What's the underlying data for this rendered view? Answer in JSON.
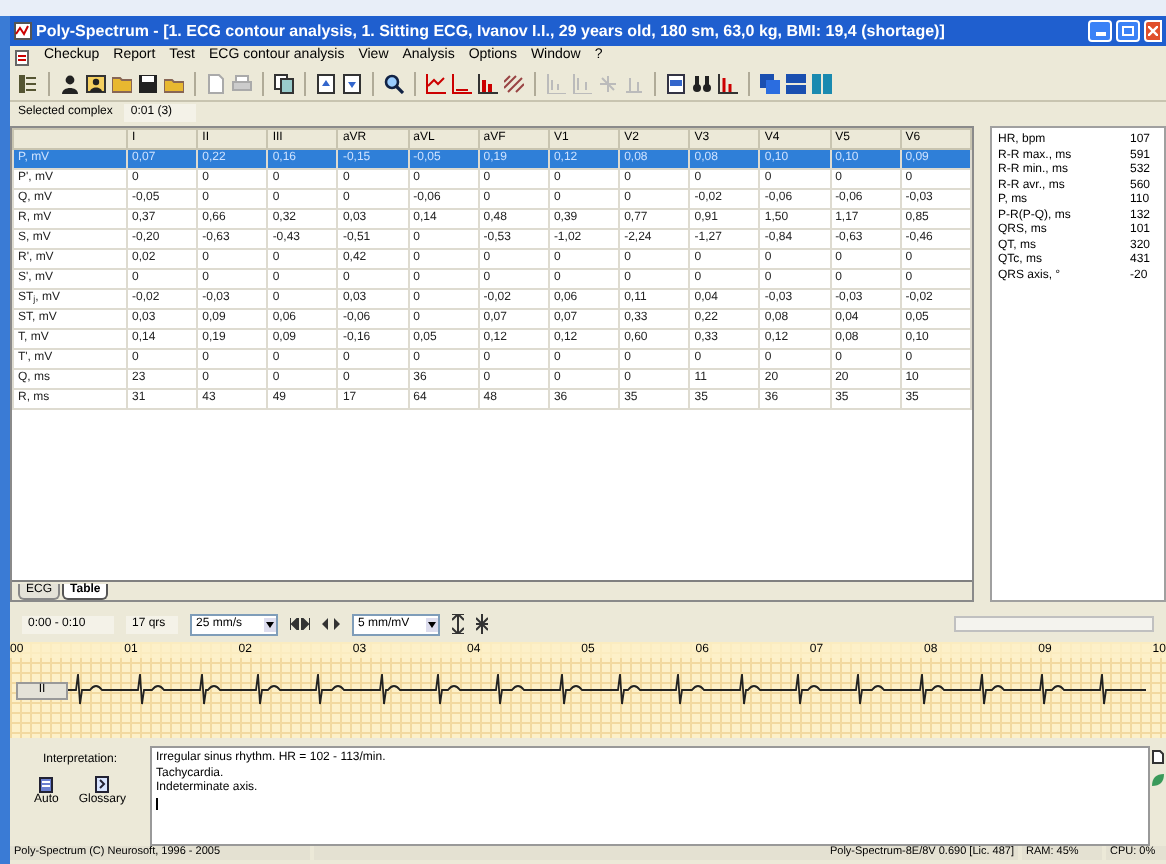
{
  "window": {
    "title": "Poly-Spectrum - [1. ECG contour analysis, 1. Sitting ECG, Ivanov I.I., 29 years old, 180 sm, 63,0 kg, BMI: 19,4 (shortage)]"
  },
  "menu": [
    "Checkup",
    "Report",
    "Test",
    "ECG contour analysis",
    "View",
    "Analysis",
    "Options",
    "Window",
    "?"
  ],
  "selected_complex": {
    "label": "Selected complex",
    "value": "0:01 (3)"
  },
  "table": {
    "columns": [
      "I",
      "II",
      "III",
      "aVR",
      "aVL",
      "aVF",
      "V1",
      "V2",
      "V3",
      "V4",
      "V5",
      "V6"
    ],
    "rows": [
      {
        "label": "P, mV",
        "selected": true,
        "cells": [
          "0,07",
          "0,22",
          "0,16",
          "-0,15",
          "-0,05",
          "0,19",
          "0,12",
          "0,08",
          "0,08",
          "0,10",
          "0,10",
          "0,09"
        ]
      },
      {
        "label": "P', mV",
        "selected": false,
        "cells": [
          "0",
          "0",
          "0",
          "0",
          "0",
          "0",
          "0",
          "0",
          "0",
          "0",
          "0",
          "0"
        ]
      },
      {
        "label": "Q, mV",
        "selected": false,
        "cells": [
          "-0,05",
          "0",
          "0",
          "0",
          "-0,06",
          "0",
          "0",
          "0",
          "-0,02",
          "-0,06",
          "-0,06",
          "-0,03"
        ]
      },
      {
        "label": "R, mV",
        "selected": false,
        "cells": [
          "0,37",
          "0,66",
          "0,32",
          "0,03",
          "0,14",
          "0,48",
          "0,39",
          "0,77",
          "0,91",
          "1,50",
          "1,17",
          "0,85"
        ]
      },
      {
        "label": "S, mV",
        "selected": false,
        "cells": [
          "-0,20",
          "-0,63",
          "-0,43",
          "-0,51",
          "0",
          "-0,53",
          "-1,02",
          "-2,24",
          "-1,27",
          "-0,84",
          "-0,63",
          "-0,46"
        ]
      },
      {
        "label": "R', mV",
        "selected": false,
        "cells": [
          "0,02",
          "0",
          "0",
          "0,42",
          "0",
          "0",
          "0",
          "0",
          "0",
          "0",
          "0",
          "0"
        ]
      },
      {
        "label": "S', mV",
        "selected": false,
        "cells": [
          "0",
          "0",
          "0",
          "0",
          "0",
          "0",
          "0",
          "0",
          "0",
          "0",
          "0",
          "0"
        ]
      },
      {
        "label": "ST$_{j}$, mV",
        "selected": false,
        "cells": [
          "-0,02",
          "-0,03",
          "0",
          "0,03",
          "0",
          "-0,02",
          "0,06",
          "0,11",
          "0,04",
          "-0,03",
          "-0,03",
          "-0,02"
        ]
      },
      {
        "label": "ST, mV",
        "selected": false,
        "cells": [
          "0,03",
          "0,09",
          "0,06",
          "-0,06",
          "0",
          "0,07",
          "0,07",
          "0,33",
          "0,22",
          "0,08",
          "0,04",
          "0,05"
        ]
      },
      {
        "label": "T, mV",
        "selected": false,
        "cells": [
          "0,14",
          "0,19",
          "0,09",
          "-0,16",
          "0,05",
          "0,12",
          "0,12",
          "0,60",
          "0,33",
          "0,12",
          "0,08",
          "0,10"
        ]
      },
      {
        "label": "T', mV",
        "selected": false,
        "cells": [
          "0",
          "0",
          "0",
          "0",
          "0",
          "0",
          "0",
          "0",
          "0",
          "0",
          "0",
          "0"
        ]
      },
      {
        "label": "Q, ms",
        "selected": false,
        "cells": [
          "23",
          "0",
          "0",
          "0",
          "36",
          "0",
          "0",
          "0",
          "11",
          "20",
          "20",
          "10"
        ]
      },
      {
        "label": "R, ms",
        "selected": false,
        "cells": [
          "31",
          "43",
          "49",
          "17",
          "64",
          "48",
          "36",
          "35",
          "35",
          "36",
          "35",
          "35"
        ]
      }
    ]
  },
  "parameters": [
    {
      "label": "HR, bpm",
      "value": "107"
    },
    {
      "label": "R-R max., ms",
      "value": "591"
    },
    {
      "label": "R-R min., ms",
      "value": "532"
    },
    {
      "label": "R-R avr., ms",
      "value": "560"
    },
    {
      "label": "P, ms",
      "value": "110"
    },
    {
      "label": "P-R(P-Q), ms",
      "value": "132"
    },
    {
      "label": "QRS, ms",
      "value": "101"
    },
    {
      "label": "QT, ms",
      "value": "320"
    },
    {
      "label": "QTc, ms",
      "value": "431"
    },
    {
      "label": "QRS axis, °",
      "value": "-20"
    }
  ],
  "tabs": [
    {
      "label": "ECG",
      "selected": false
    },
    {
      "label": "Table",
      "selected": true
    }
  ],
  "ecg_toolbar": {
    "range": "0:00 - 0:10",
    "qrs_count": "17 qrs",
    "speed": "25 mm/s",
    "gain": "5 mm/mV"
  },
  "ecg_strip": {
    "time_labels": [
      "00",
      "01",
      "02",
      "03",
      "04",
      "05",
      "06",
      "07",
      "08",
      "09",
      "10"
    ],
    "lead": "II"
  },
  "interpretation": {
    "label": "Interpretation:",
    "buttons": [
      "Auto",
      "Glossary"
    ],
    "lines": [
      "Irregular sinus rhythm. HR = 102 - 113/min.",
      "Tachycardia.",
      "Indeterminate axis."
    ]
  },
  "status_bar": [
    "Poly-Spectrum (C) Neurosoft, 1996 - 2005",
    "Poly-Spectrum-8E/8V 0.690 [Lic. 487]",
    "RAM: 45%",
    "CPU: 0%"
  ]
}
